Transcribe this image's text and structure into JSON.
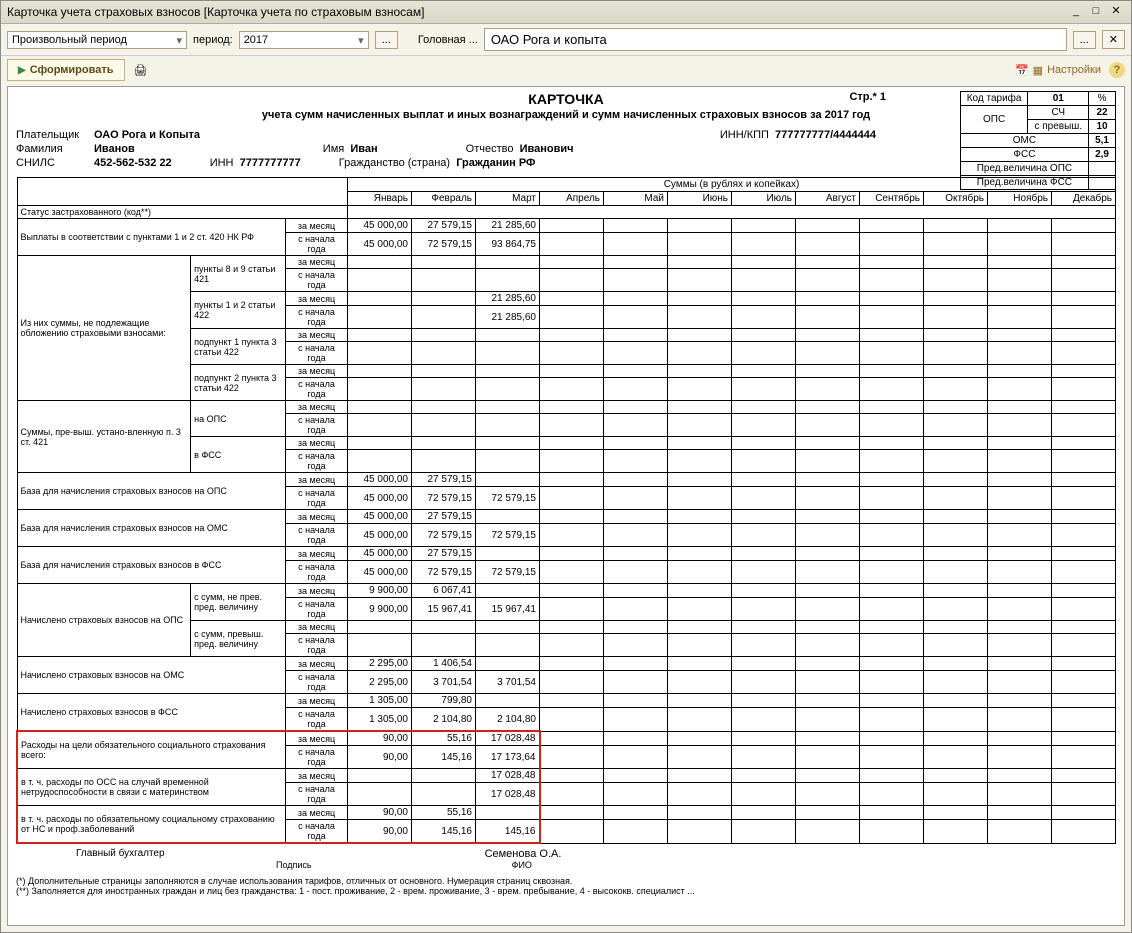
{
  "window_title": "Карточка учета страховых взносов [Карточка учета по страховым взносам]",
  "toolbar": {
    "period_type": "Произвольный период",
    "period_label": "период:",
    "year": "2017",
    "org_label": "Головная ...",
    "org_name": "ОАО Рога и копыта",
    "form_btn": "Сформировать",
    "settings": "Настройки"
  },
  "doc": {
    "title": "КАРТОЧКА",
    "subtitle": "учета сумм начисленных выплат и иных вознаграждений и сумм начисленных страховых взносов за 2017 год",
    "page": "Стр.* 1"
  },
  "rates": {
    "code_tarif_lbl": "Код тарифа",
    "code_tarif": "01",
    "pct": "%",
    "ops_lbl": "ОПС",
    "sch_lbl": "СЧ",
    "sch": "22",
    "excess_lbl": "с превыш.",
    "excess": "10",
    "oms_lbl": "ОМС",
    "oms": "5,1",
    "fss_lbl": "ФСС",
    "fss": "2,9",
    "pred_ops": "Пред.величина ОПС",
    "pred_fss": "Пред.величина ФСС"
  },
  "info": {
    "payer_lbl": "Плательщик",
    "payer": "ОАО Рога и Копыта",
    "inn_kpp_lbl": "ИНН/КПП",
    "inn_kpp": "777777777/4444444",
    "fam_lbl": "Фамилия",
    "fam": "Иванов",
    "name_lbl": "Имя",
    "name": "Иван",
    "patr_lbl": "Отчество",
    "patr": "Иванович",
    "snils_lbl": "СНИЛС",
    "snils": "452-562-532 22",
    "inn_lbl": "ИНН",
    "inn": "7777777777",
    "citizen_lbl": "Гражданство (страна)",
    "citizen": "Гражданин РФ"
  },
  "table_header": {
    "sums": "Суммы (в рублях и копейках)",
    "months": [
      "Январь",
      "Февраль",
      "Март",
      "Апрель",
      "Май",
      "Июнь",
      "Июль",
      "Август",
      "Сентябрь",
      "Октябрь",
      "Ноябрь",
      "Декабрь"
    ]
  },
  "periods": {
    "month": "за месяц",
    "year": "с начала года"
  },
  "rows": {
    "status": "Статус застрахованного (код**)",
    "r1": "Выплаты в соответствии с пунктами 1 и 2 ст. 420 НК РФ",
    "grp1": "Из них суммы, не подлежащие обложению страховыми взносами:",
    "g1a": "пункты 8 и 9 статьи 421",
    "g1b": "пункты 1 и 2 статьи 422",
    "g1c": "подпункт 1 пункта 3 статьи 422",
    "g1d": "подпункт 2 пункта 3 статьи 422",
    "grp2": "Суммы, пре-выш. устано-вленную п. 3 ст. 421",
    "g2a": "на ОПС",
    "g2b": "в ФСС",
    "r_ops": "База для начисления страховых взносов на ОПС",
    "r_oms": "База для начисления страховых взносов на ОМС",
    "r_fss": "База для начисления страховых взносов в ФСС",
    "grp3": "Начислено страховых взносов на ОПС",
    "g3a": "с сумм, не прев. пред. величину",
    "g3b": "с сумм, превыш. пред. величину",
    "r_noms": "Начислено страховых взносов на ОМС",
    "r_nfss": "Начислено страховых взносов в ФСС",
    "r_exp": "Расходы на цели обязательного социального страхования всего:",
    "r_oss": "в т. ч. расходы по ОСС на случай временной нетрудоспособности в связи с материнством",
    "r_ns": "в т. ч. расходы по обязательному социальному страхованию от НС и проф.заболеваний"
  },
  "data": {
    "r1_m": [
      "45 000,00",
      "27 579,15",
      "21 285,60"
    ],
    "r1_y": [
      "45 000,00",
      "72 579,15",
      "93 864,75"
    ],
    "g1b_m": [
      "",
      "",
      "21 285,60"
    ],
    "g1b_y": [
      "",
      "",
      "21 285,60"
    ],
    "ops_m": [
      "45 000,00",
      "27 579,15",
      ""
    ],
    "ops_y": [
      "45 000,00",
      "72 579,15",
      "72 579,15"
    ],
    "oms_m": [
      "45 000,00",
      "27 579,15",
      ""
    ],
    "oms_y": [
      "45 000,00",
      "72 579,15",
      "72 579,15"
    ],
    "fss_m": [
      "45 000,00",
      "27 579,15",
      ""
    ],
    "fss_y": [
      "45 000,00",
      "72 579,15",
      "72 579,15"
    ],
    "g3a_m": [
      "9 900,00",
      "6 067,41",
      ""
    ],
    "g3a_y": [
      "9 900,00",
      "15 967,41",
      "15 967,41"
    ],
    "noms_m": [
      "2 295,00",
      "1 406,54",
      ""
    ],
    "noms_y": [
      "2 295,00",
      "3 701,54",
      "3 701,54"
    ],
    "nfss_m": [
      "1 305,00",
      "799,80",
      ""
    ],
    "nfss_y": [
      "1 305,00",
      "2 104,80",
      "2 104,80"
    ],
    "exp_m": [
      "90,00",
      "55,16",
      "17 028,48"
    ],
    "exp_y": [
      "90,00",
      "145,16",
      "17 173,64"
    ],
    "oss_m": [
      "",
      "",
      "17 028,48"
    ],
    "oss_y": [
      "",
      "",
      "17 028,48"
    ],
    "ns_m": [
      "90,00",
      "55,16",
      ""
    ],
    "ns_y": [
      "90,00",
      "145,16",
      "145,16"
    ]
  },
  "signature": {
    "role": "Главный бухгалтер",
    "fio": "Семенова О.А.",
    "sign_lbl": "Подпись",
    "fio_lbl": "ФИО"
  },
  "footnotes": {
    "f1": "(*) Дополнительные страницы заполняются в случае использования тарифов, отличных от основного. Нумерация страниц сквозная.",
    "f2": "(**) Заполняется для иностранных граждан и лиц без гражданства: 1 - пост. проживание, 2 - врем. проживание, 3 - врем. пребывание, 4 - высококв. специалист ..."
  }
}
